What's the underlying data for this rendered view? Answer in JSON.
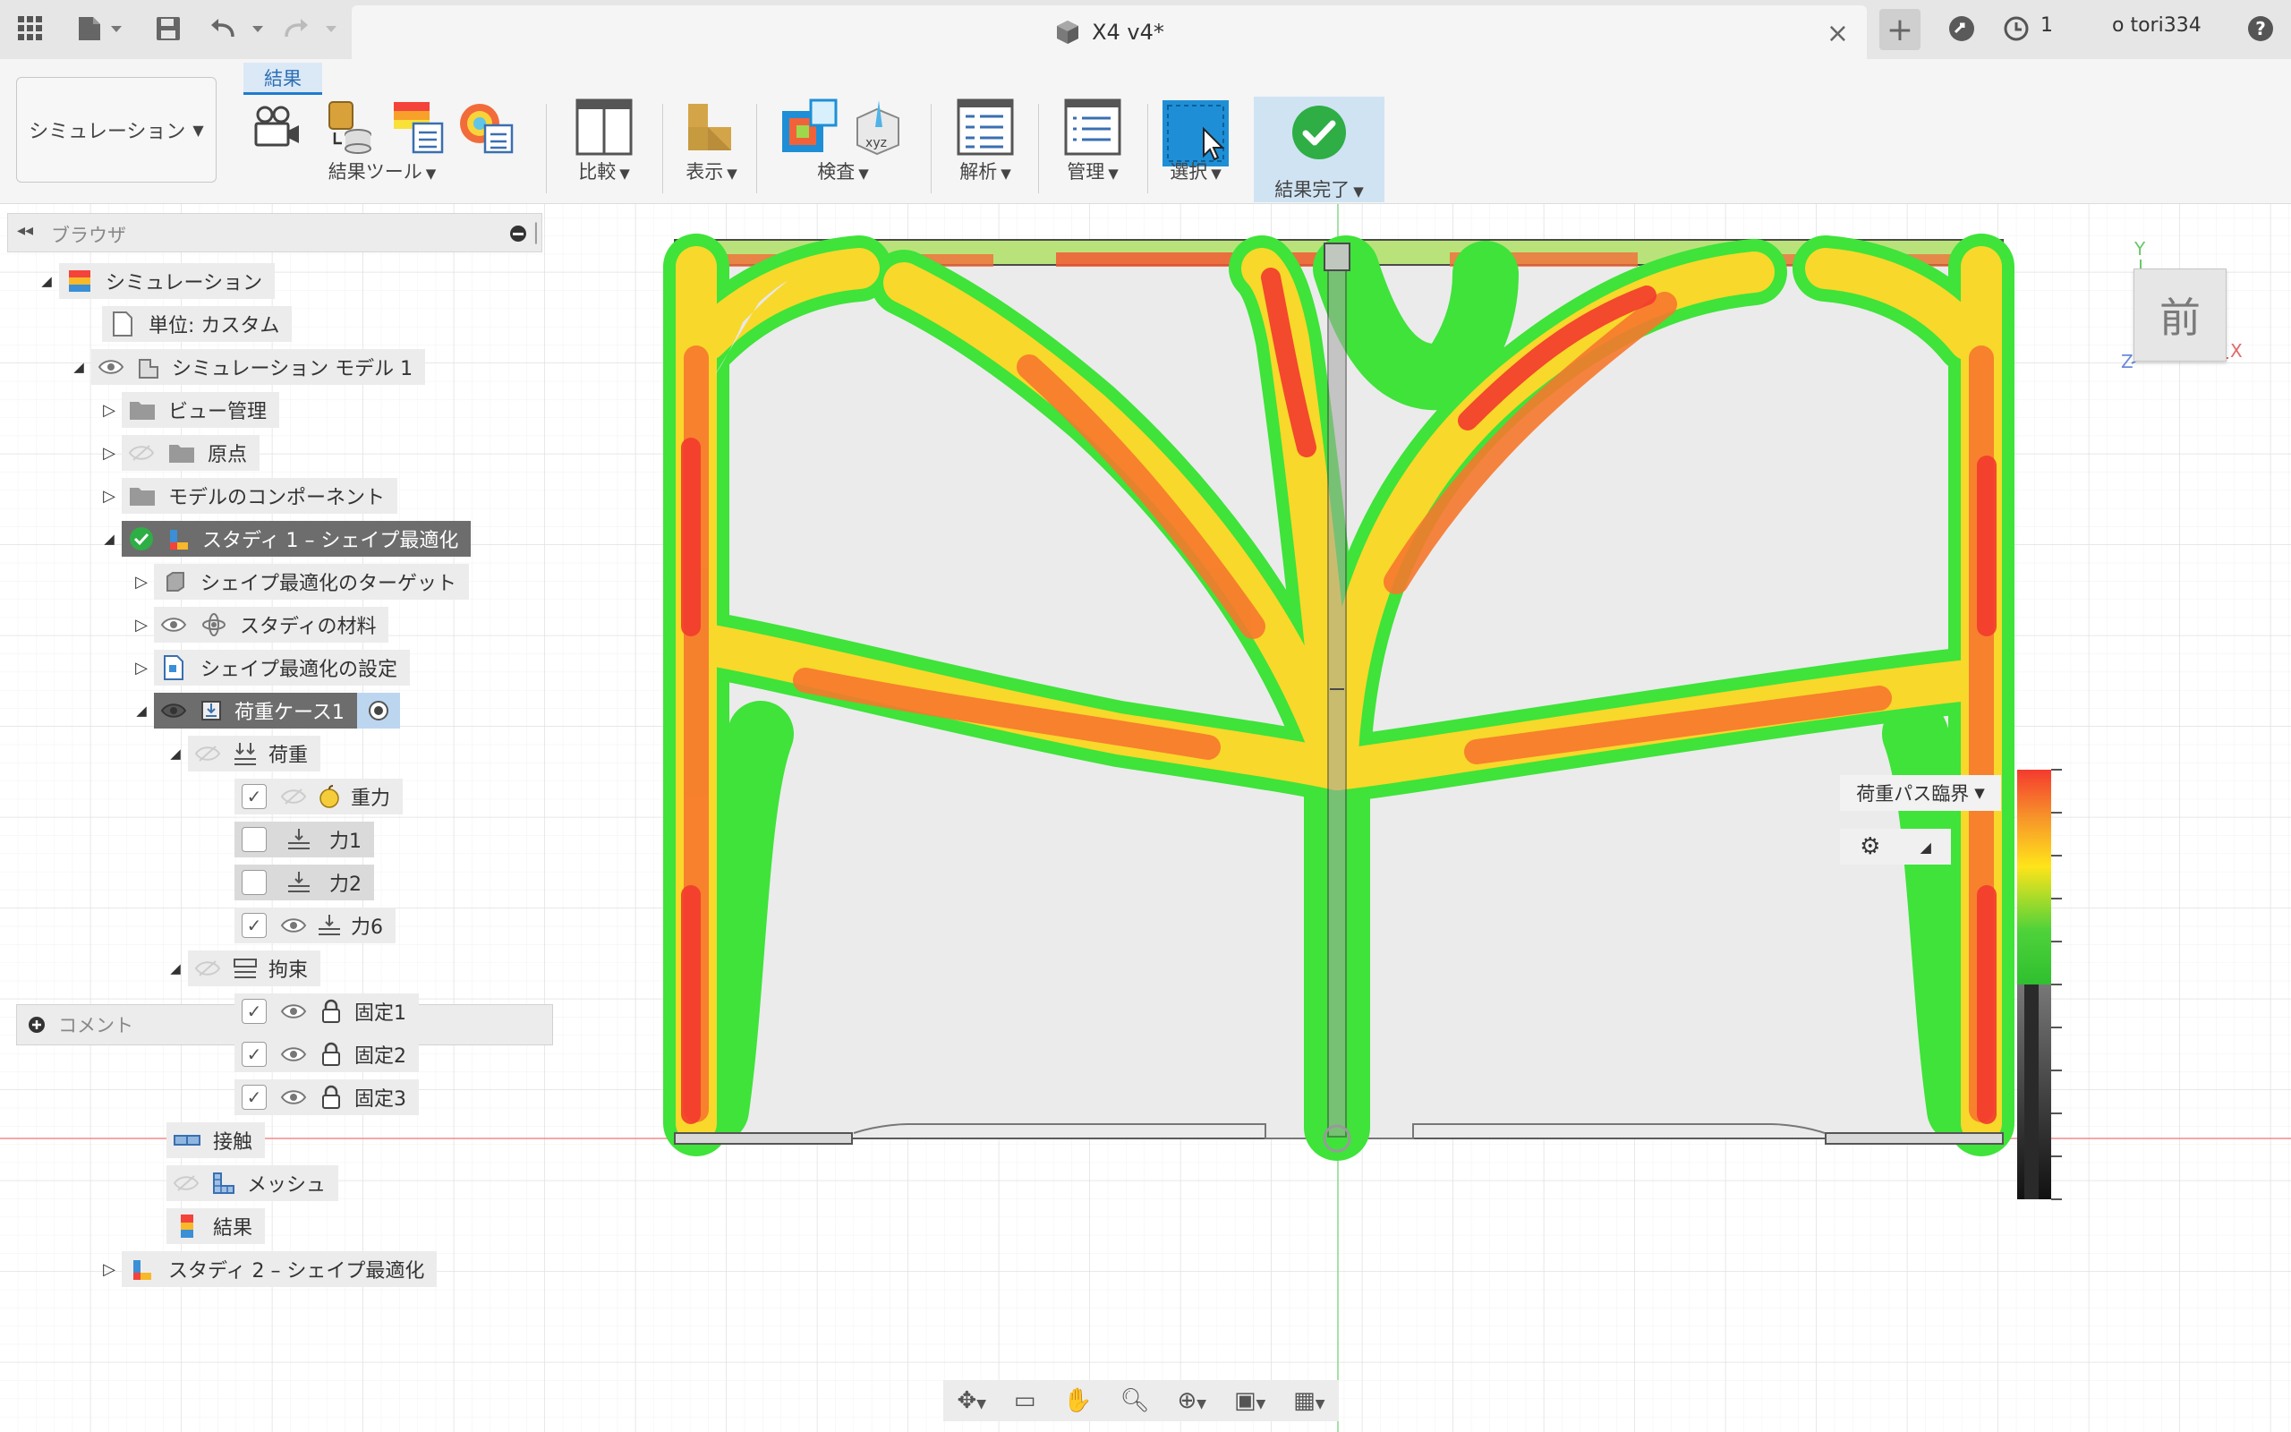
{
  "titlebar": {
    "document_title": "X4 v4*",
    "notification_count": "1",
    "user_name": "o tori334",
    "help": "?"
  },
  "toolbar": {
    "workspace": "シミュレーション",
    "active_tab": "結果",
    "groups": {
      "result_tools": "結果ツール",
      "compare": "比較",
      "display": "表示",
      "inspect": "検査",
      "analysis": "解析",
      "manage": "管理",
      "select": "選択",
      "finish": "結果完了"
    }
  },
  "browser": {
    "title": "ブラウザ",
    "tree": {
      "simulation": "シミュレーション",
      "units": "単位: カスタム",
      "model": "シミュレーション モデル 1",
      "view_mgmt": "ビュー管理",
      "origin": "原点",
      "model_components": "モデルのコンポーネント",
      "study1": "スタディ 1 – シェイプ最適化",
      "target": "シェイプ最適化のターゲット",
      "material": "スタディの材料",
      "settings": "シェイプ最適化の設定",
      "load_case": "荷重ケース1",
      "loads": "荷重",
      "gravity": "重力",
      "force1": "力1",
      "force2": "力2",
      "force6": "力6",
      "constraints": "拘束",
      "fixed1": "固定1",
      "fixed2": "固定2",
      "fixed3": "固定3",
      "contact": "接触",
      "mesh": "メッシュ",
      "results": "結果",
      "study2": "スタディ 2 – シェイプ最適化"
    },
    "checks": {
      "gravity": true,
      "force1": false,
      "force2": false,
      "force6": true,
      "fixed1": true,
      "fixed2": true,
      "fixed3": true
    }
  },
  "comments": {
    "label": "コメント"
  },
  "viewport": {
    "legend_label": "荷重パス臨界",
    "viewcube_face": "前",
    "axis_y": "Y",
    "axis_z": "Z",
    "axis_x": "X"
  },
  "colors": {
    "accent": "#1f7bd0",
    "select_blue": "#1e8fd6",
    "finish_green": "#2eae45",
    "selected_row": "#6d6d6d",
    "grid": "#e2e2e2",
    "high": "#f43a2e",
    "mid": "#ffd21a",
    "low": "#3fe33a"
  }
}
